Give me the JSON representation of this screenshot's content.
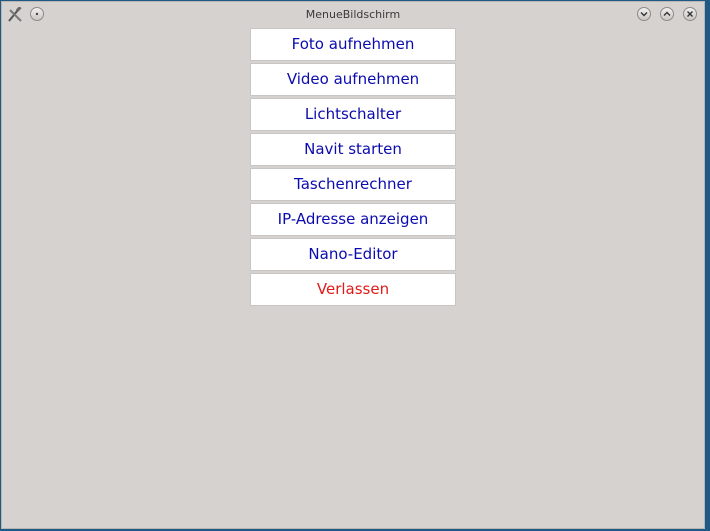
{
  "window": {
    "title": "MenueBildschirm",
    "controls": {
      "minimize_icon": "chevron-down-icon",
      "maximize_icon": "chevron-up-icon",
      "close_icon": "close-icon"
    }
  },
  "menu": {
    "items": [
      {
        "label": "Foto aufnehmen"
      },
      {
        "label": "Video aufnehmen"
      },
      {
        "label": "Lichtschalter"
      },
      {
        "label": "Navit starten"
      },
      {
        "label": "Taschenrechner"
      },
      {
        "label": "IP-Adresse anzeigen"
      },
      {
        "label": "Nano-Editor"
      },
      {
        "label": "Verlassen"
      }
    ]
  },
  "colors": {
    "button_text": "#0b0bb0",
    "exit_text": "#e11a1a",
    "window_bg": "#d6d2d0"
  }
}
